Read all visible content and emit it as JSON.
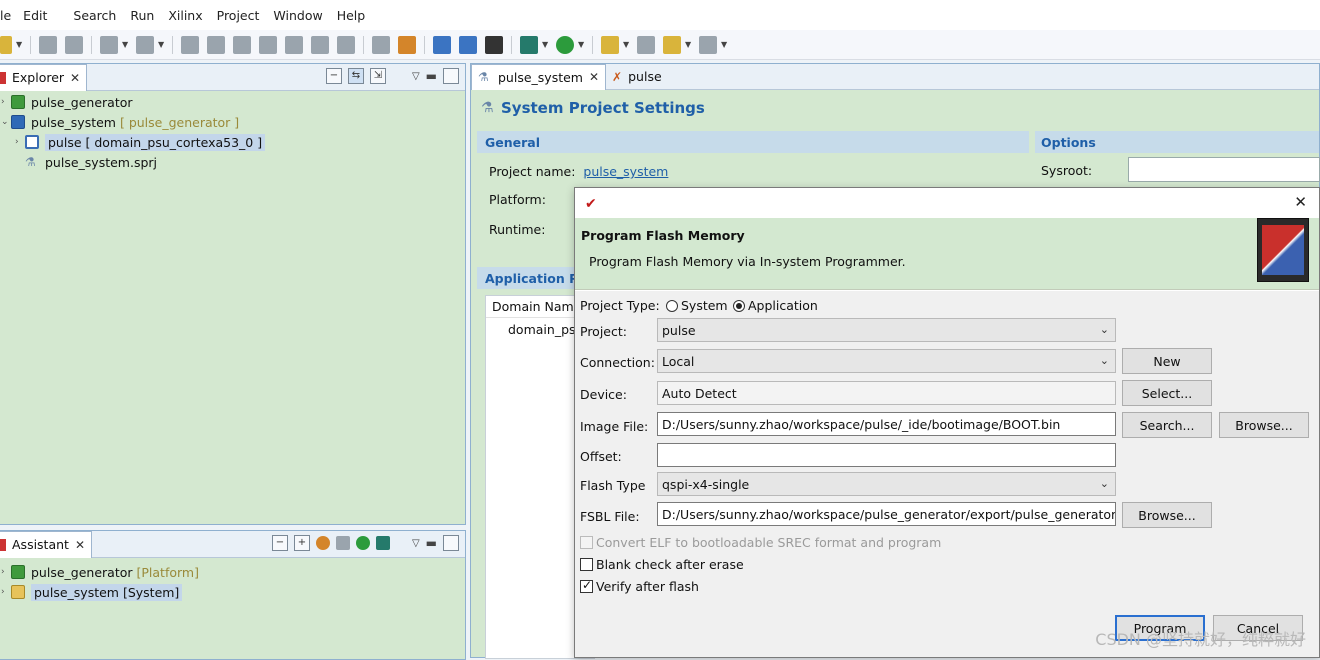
{
  "menu": [
    "le",
    "Edit",
    "Search",
    "Run",
    "Xilinx",
    "Project",
    "Window",
    "Help"
  ],
  "explorer": {
    "tab_label": "Explorer",
    "items": [
      {
        "label": "pulse_generator",
        "suffix": ""
      },
      {
        "label": "pulse_system",
        "suffix": "[ pulse_generator ]"
      },
      {
        "label": "pulse [ domain_psu_cortexa53_0 ]",
        "suffix": ""
      },
      {
        "label": "pulse_system.sprj",
        "suffix": ""
      }
    ]
  },
  "assistant": {
    "tab_label": "Assistant",
    "items": [
      {
        "label": "pulse_generator",
        "suffix": "[Platform]"
      },
      {
        "label": "pulse_system [System]",
        "suffix": ""
      }
    ]
  },
  "editor": {
    "tabs": [
      "pulse_system",
      "pulse"
    ],
    "heading": "System Project Settings",
    "general_title": "General",
    "options_title": "Options",
    "project_name_label": "Project name:",
    "project_name_value": "pulse_system",
    "platform_label": "Platform:",
    "runtime_label": "Runtime:",
    "sysroot_label": "Sysroot:",
    "app_projects_title": "Application Pr",
    "domain_col": "Domain Name",
    "domain_row": "domain_psu"
  },
  "dialog": {
    "title_text": "Program Flash Memory",
    "subtitle": "Program Flash Memory via In-system Programmer.",
    "project_type_label": "Project Type:",
    "project_type_system": "System",
    "project_type_application": "Application",
    "project_label": "Project:",
    "project_value": "pulse",
    "connection_label": "Connection:",
    "connection_value": "Local",
    "new_button": "New",
    "device_label": "Device:",
    "device_value": "Auto Detect",
    "select_button": "Select...",
    "image_file_label": "Image File:",
    "image_file_value": "D:/Users/sunny.zhao/workspace/pulse/_ide/bootimage/BOOT.bin",
    "search_button": "Search...",
    "browse_button": "Browse...",
    "offset_label": "Offset:",
    "offset_value": "",
    "flash_type_label": "Flash Type",
    "flash_type_value": "qspi-x4-single",
    "fsbl_label": "FSBL File:",
    "fsbl_value": "D:/Users/sunny.zhao/workspace/pulse_generator/export/pulse_generator/sw/",
    "fsbl_browse_button": "Browse...",
    "convert_elf_label": "Convert ELF to bootloadable SREC format and program",
    "blank_check_label": "Blank check after erase",
    "verify_label": "Verify after flash",
    "program_button": "Program",
    "cancel_button": "Cancel"
  },
  "watermark": "CSDN @坚持就好，纯粹就好",
  "colors": {
    "panel_green": "#d4e8d0",
    "accent_blue": "#1f5fa8",
    "dialog_body": "#f0f0f0"
  }
}
